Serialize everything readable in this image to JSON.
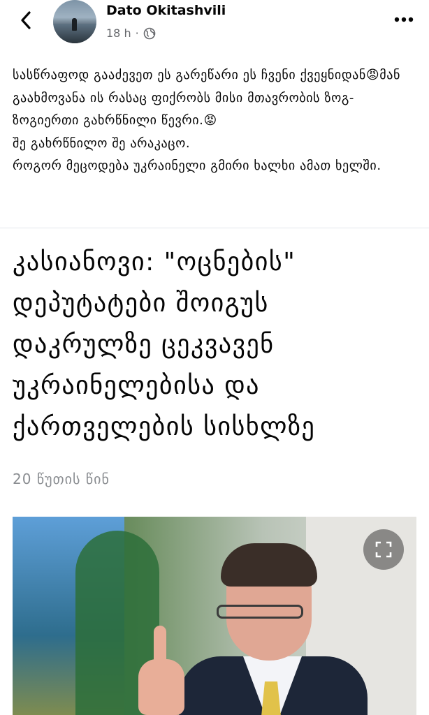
{
  "header": {
    "author_name": "Dato Okitashvili",
    "timestamp": "18 h",
    "separator": "·",
    "back_icon": "chevron-left-icon",
    "privacy_icon": "globe-icon",
    "more_icon": "more-horizontal-icon"
  },
  "post": {
    "text": "სასწრაფოდ გააძევეთ ეს გარეწარი ეს ჩვენი ქვეყნიდან😡მან გაახმოვანა ის რასაც ფიქრობს მისი მთავრობის ზოგ-ზოგიერთი გახრწნილი წევრი.😡\nშე გახრწნილო შე არაკაცო.\nროგორ მეცოდება უკრაინელი გმირი ხალხი ამათ ხელში."
  },
  "article": {
    "headline": "კასიანოვი: \"ოცნების\"\nდეპუტატები შოიგუს\nდაკრულზე ცეკვავენ\nუკრაინელებისა და\nქართველების სისხლზე",
    "time_ago": "20 წუთის წინ",
    "expand_icon": "expand-icon"
  }
}
